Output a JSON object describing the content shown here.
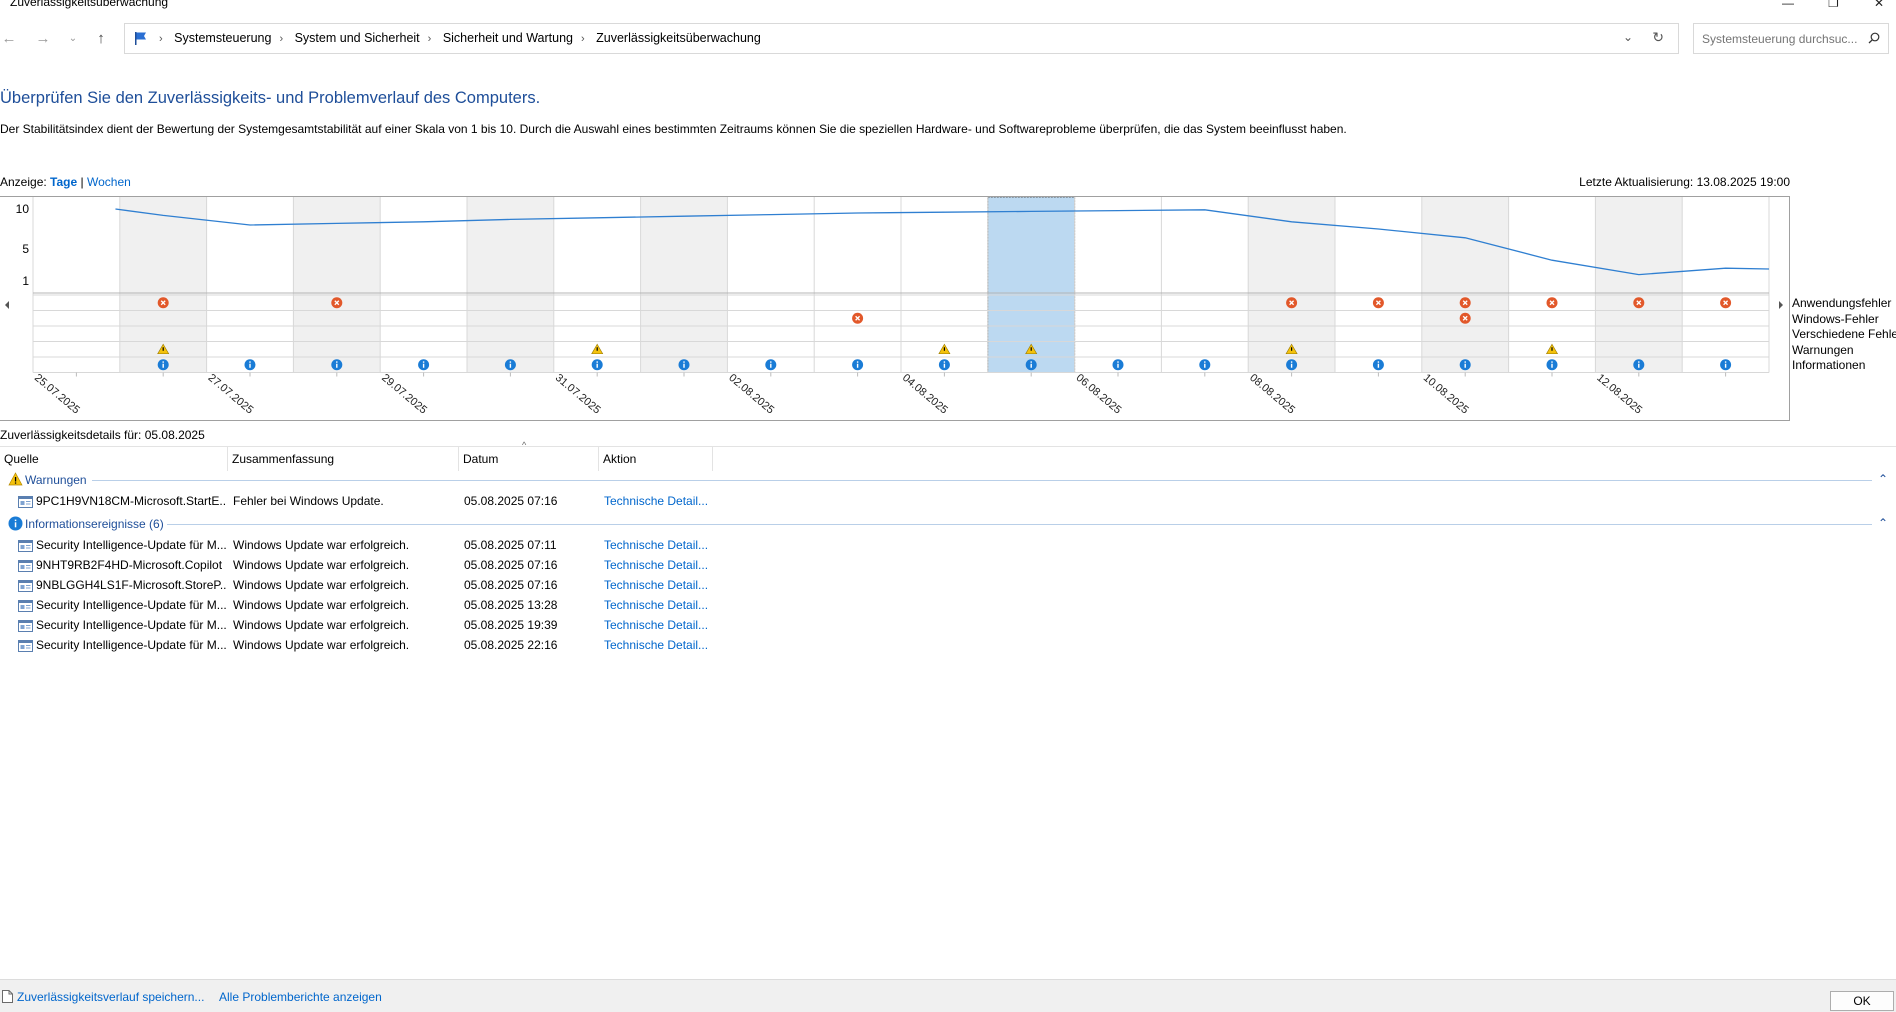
{
  "window": {
    "title": "Zuverlässigkeitsüberwachung"
  },
  "breadcrumbs": [
    "Systemsteuerung",
    "System und Sicherheit",
    "Sicherheit und Wartung",
    "Zuverlässigkeitsüberwachung"
  ],
  "search": {
    "placeholder": "Systemsteuerung durchsuc..."
  },
  "heading": "Überprüfen Sie den Zuverlässigkeits- und Problemverlauf des Computers.",
  "description": "Der Stabilitätsindex dient der Bewertung der Systemgesamtstabilität auf einer Skala von 1 bis 10. Durch die Auswahl eines bestimmten Zeitraums können Sie die speziellen Hardware- und Softwareprobleme überprüfen, die das System beeinflusst haben.",
  "view": {
    "label": "Anzeige:",
    "days": "Tage",
    "sep": "|",
    "weeks": "Wochen"
  },
  "last_update": "Letzte Aktualisierung: 13.08.2025 19:00",
  "chart_data": {
    "type": "line",
    "y_ticks": [
      "10",
      "5",
      "1"
    ],
    "ylim": [
      1,
      10
    ],
    "grid": true,
    "x": [
      "25.07.2025",
      "26.07.2025",
      "27.07.2025",
      "28.07.2025",
      "29.07.2025",
      "30.07.2025",
      "31.07.2025",
      "01.08.2025",
      "02.08.2025",
      "03.08.2025",
      "04.08.2025",
      "05.08.2025",
      "06.08.2025",
      "07.08.2025",
      "08.08.2025",
      "09.08.2025",
      "10.08.2025",
      "11.08.2025",
      "12.08.2025",
      "13.08.2025"
    ],
    "x_tick_labels": [
      "25.07.2025",
      "27.07.2025",
      "29.07.2025",
      "31.07.2025",
      "02.08.2025",
      "04.08.2025",
      "06.08.2025",
      "08.08.2025",
      "10.08.2025",
      "12.08.2025"
    ],
    "stability_index": [
      10,
      9.2,
      8.0,
      8.2,
      8.4,
      8.7,
      8.9,
      9.1,
      9.3,
      9.5,
      9.6,
      9.7,
      9.8,
      9.9,
      8.4,
      7.5,
      6.4,
      3.6,
      1.8,
      2.6
    ],
    "selected_day": "05.08.2025",
    "event_rows": [
      "Anwendungsfehler",
      "Windows-Fehler",
      "Verschiedene Fehler",
      "Warnungen",
      "Informationen"
    ],
    "events": {
      "Anwendungsfehler": [
        "26.07.2025",
        "28.07.2025",
        "08.08.2025",
        "09.08.2025",
        "10.08.2025",
        "11.08.2025",
        "12.08.2025",
        "13.08.2025"
      ],
      "Windows-Fehler": [
        "03.08.2025",
        "10.08.2025"
      ],
      "Verschiedene Fehler": [],
      "Warnungen": [
        "26.07.2025",
        "31.07.2025",
        "04.08.2025",
        "05.08.2025",
        "08.08.2025",
        "11.08.2025"
      ],
      "Informationen": [
        "26.07.2025",
        "27.07.2025",
        "28.07.2025",
        "29.07.2025",
        "30.07.2025",
        "31.07.2025",
        "01.08.2025",
        "02.08.2025",
        "03.08.2025",
        "04.08.2025",
        "05.08.2025",
        "06.08.2025",
        "07.08.2025",
        "08.08.2025",
        "09.08.2025",
        "10.08.2025",
        "11.08.2025",
        "12.08.2025",
        "13.08.2025"
      ]
    },
    "colors": {
      "line": "#2f7fd1",
      "error": "#e2582a",
      "warning": "#f4c20d",
      "info": "#1a7cd6",
      "selection": "#bcd9f1",
      "shade": "#f0f0f0"
    }
  },
  "details_label": "Zuverlässigkeitsdetails für: 05.08.2025",
  "table": {
    "columns": [
      "Quelle",
      "Zusammenfassung",
      "Datum",
      "Aktion"
    ],
    "groups": [
      {
        "label": "Warnungen",
        "icon": "warning-icon",
        "rows": [
          {
            "source": "9PC1H9VN18CM-Microsoft.StartE...",
            "summary": "Fehler bei Windows Update.",
            "date": "05.08.2025 07:16",
            "action": "Technische Detail..."
          }
        ]
      },
      {
        "label": "Informationsereignisse (6)",
        "icon": "info-icon",
        "rows": [
          {
            "source": "Security Intelligence-Update für M...",
            "summary": "Windows Update war erfolgreich.",
            "date": "05.08.2025 07:11",
            "action": "Technische Detail..."
          },
          {
            "source": "9NHT9RB2F4HD-Microsoft.Copilot",
            "summary": "Windows Update war erfolgreich.",
            "date": "05.08.2025 07:16",
            "action": "Technische Detail..."
          },
          {
            "source": "9NBLGGH4LS1F-Microsoft.StoreP...",
            "summary": "Windows Update war erfolgreich.",
            "date": "05.08.2025 07:16",
            "action": "Technische Detail..."
          },
          {
            "source": "Security Intelligence-Update für M...",
            "summary": "Windows Update war erfolgreich.",
            "date": "05.08.2025 13:28",
            "action": "Technische Detail..."
          },
          {
            "source": "Security Intelligence-Update für M...",
            "summary": "Windows Update war erfolgreich.",
            "date": "05.08.2025 19:39",
            "action": "Technische Detail..."
          },
          {
            "source": "Security Intelligence-Update für M...",
            "summary": "Windows Update war erfolgreich.",
            "date": "05.08.2025 22:16",
            "action": "Technische Detail..."
          }
        ]
      }
    ]
  },
  "footer": {
    "save_link": "Zuverlässigkeitsverlauf speichern...",
    "reports_link": "Alle Problemberichte anzeigen",
    "ok": "OK"
  }
}
